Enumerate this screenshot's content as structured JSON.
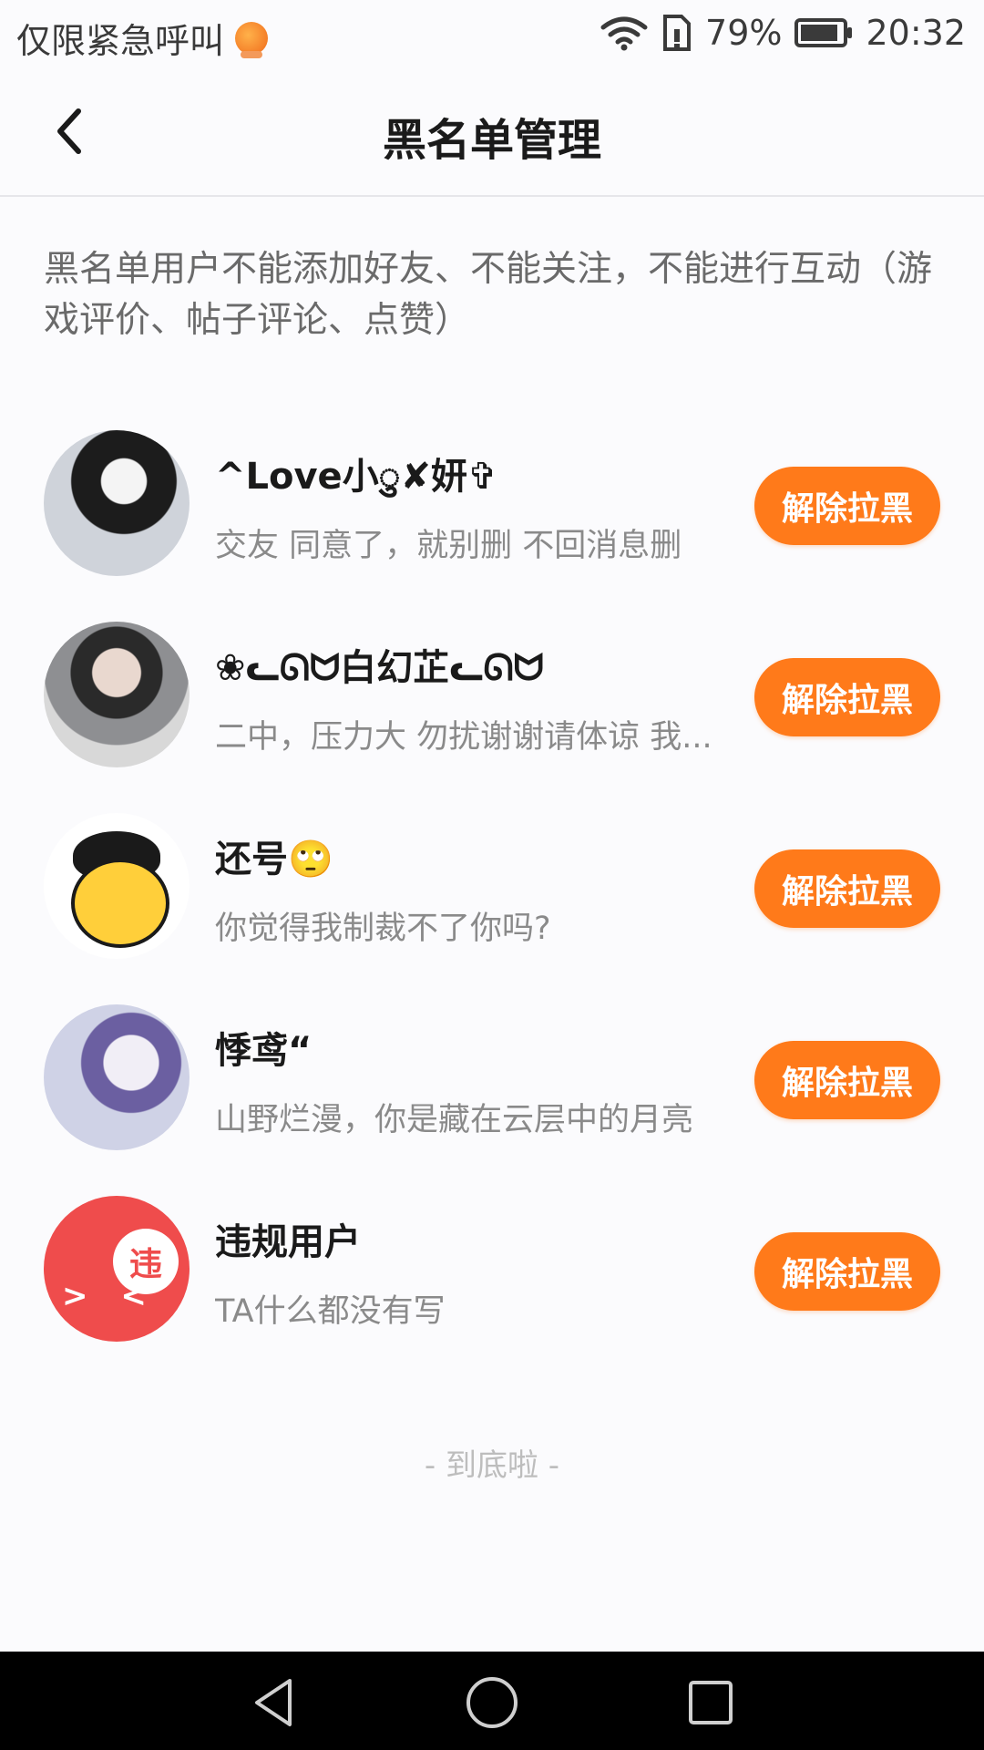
{
  "status_bar": {
    "carrier_text": "仅限紧急呼叫",
    "battery_text": "79%",
    "time": "20:32",
    "icons": [
      "app-badge-icon",
      "wifi-icon",
      "sim-icon",
      "battery-icon"
    ]
  },
  "header": {
    "back_icon": "chevron-left-icon",
    "title": "黑名单管理"
  },
  "notice": "黑名单用户不能添加好友、不能关注，不能进行互动（游戏评价、帖子评论、点赞）",
  "users": [
    {
      "name": "^Love小ु✘妍✞",
      "bio": "交友 同意了，就别删 不回消息删",
      "button": "解除拉黑"
    },
    {
      "name": "❀ᓚᘏᗢ白幻芷ᓚᘏᗢ",
      "bio": "二中，压力大 勿扰谢谢请体谅 我...",
      "button": "解除拉黑"
    },
    {
      "name": "还号🙄",
      "bio": "你觉得我制裁不了你吗?",
      "button": "解除拉黑"
    },
    {
      "name": "悸鸢“",
      "bio": "山野烂漫，你是藏在云层中的月亮",
      "button": "解除拉黑"
    },
    {
      "name": "违规用户",
      "bio": "TA什么都没有写",
      "button": "解除拉黑",
      "avatar_badge": "违",
      "avatar_face": "> <"
    }
  ],
  "end_text": "- 到底啦 -",
  "colors": {
    "accent": "#ff7a1a",
    "violation": "#ef4c4c"
  },
  "system_nav": [
    "back-triangle-icon",
    "home-circle-icon",
    "recent-square-icon"
  ]
}
